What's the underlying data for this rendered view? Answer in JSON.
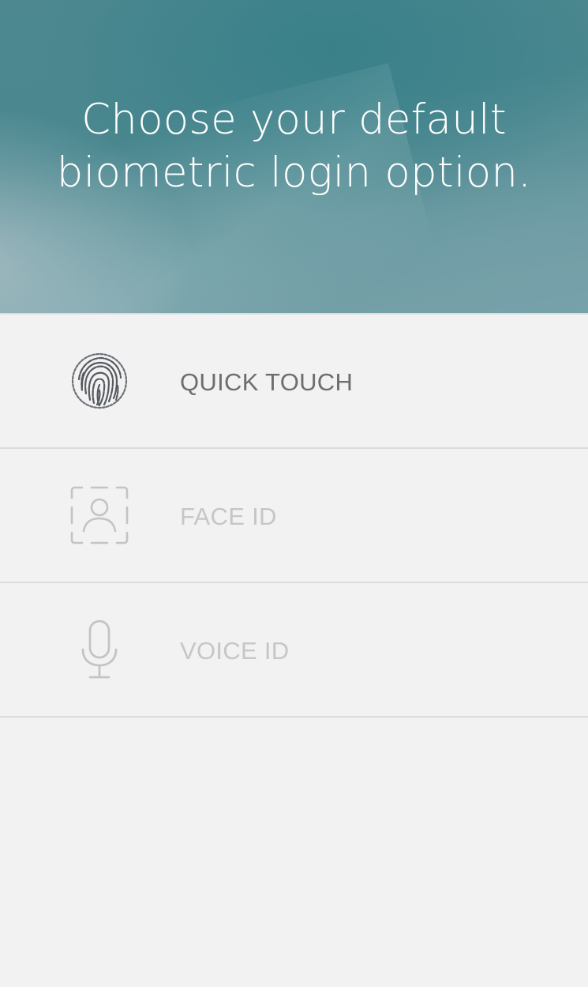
{
  "header": {
    "title_line1": "Choose your default",
    "title_line2": "biometric login option."
  },
  "options": [
    {
      "label": "QUICK TOUCH",
      "icon": "fingerprint-icon",
      "state": "active",
      "color": "#6e6e6e"
    },
    {
      "label": "FACE ID",
      "icon": "face-id-icon",
      "state": "disabled",
      "color": "#c6c6c6"
    },
    {
      "label": "VOICE ID",
      "icon": "microphone-icon",
      "state": "disabled",
      "color": "#c6c6c6"
    }
  ],
  "colors": {
    "header_teal": "#4a878f",
    "background": "#f2f2f2",
    "divider": "#dcdcdc"
  }
}
